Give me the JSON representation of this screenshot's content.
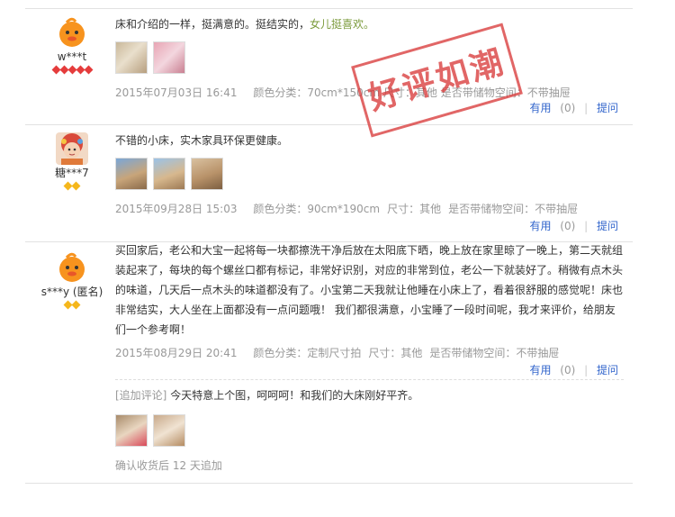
{
  "reviews": [
    {
      "username": "w***t",
      "avatar": "orange-chick-avatar",
      "rank_color": "#e53c3c",
      "content_plain": "床和介绍的一样，挺满意的。挺结实的，",
      "content_highlight": "女儿挺喜欢。",
      "date": "2015年07月03日 16:41",
      "sku": "颜色分类：70cm*150cm 尺寸：其他 是否带储物空间：不带抽屉",
      "useful_label": "有用",
      "useful_count": "(0)",
      "ask_label": "提问"
    },
    {
      "username": "糖***7",
      "avatar": "baby-photo-avatar",
      "rank_color": "#f5b71c",
      "content_plain": "不错的小床，实木家具环保更健康。",
      "date": "2015年09月28日 15:03",
      "sku_color": "颜色分类：90cm*190cm",
      "sku_size": "尺寸：其他",
      "sku_storage": "是否带储物空间：不带抽屉",
      "useful_label": "有用",
      "useful_count": "(0)",
      "ask_label": "提问"
    },
    {
      "username": "s***y (匿名)",
      "avatar": "orange-chick-avatar",
      "rank_color": "#f5b71c",
      "content_plain": "买回家后，老公和大宝一起将每一块都擦洗干净后放在太阳底下晒，晚上放在家里晾了一晚上，第二天就组装起来了，每块的每个螺丝口都有标记，非常好识别，对应的非常到位，老公一下就装好了。稍微有点木头的味道，几天后一点木头的味道都没有了。小宝第二天我就让他睡在小床上了，看着很舒服的感觉呢！床也非常结实，大人坐在上面都没有一点问题哦！ 我们都很满意，小宝睡了一段时间呢，我才来评价，给朋友们一个参考啊！",
      "date": "2015年08月29日 20:41",
      "sku_color": "颜色分类：定制尺寸拍",
      "sku_size": "尺寸：其他",
      "sku_storage": "是否带储物空间：不带抽屉",
      "useful_label": "有用",
      "useful_count": "(0)",
      "ask_label": "提问",
      "append_tag": "[追加评论]",
      "append_text": "今天特意上个图，呵呵呵！和我们的大床刚好平齐。",
      "append_time": "确认收货后 12 天追加"
    }
  ],
  "stamp_text": "好评如潮",
  "colors": {
    "link": "#3366cc",
    "highlight": "#7a9a3a",
    "meta": "#999999",
    "stamp": "#d83434"
  }
}
